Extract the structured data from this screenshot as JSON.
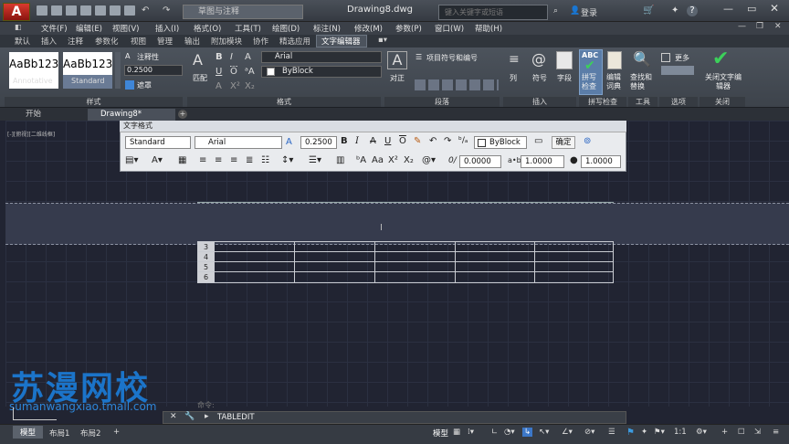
{
  "app": {
    "doc_title": "Drawing8.dwg",
    "workspace": "草图与注释",
    "search_placeholder": "键入关键字或短语",
    "login": "登录"
  },
  "menu": [
    "文件(F)",
    "编辑(E)",
    "视图(V)",
    "插入(I)",
    "格式(O)",
    "工具(T)",
    "绘图(D)",
    "标注(N)",
    "修改(M)",
    "参数(P)",
    "窗口(W)",
    "帮助(H)"
  ],
  "ribbon_tabs": [
    "默认",
    "插入",
    "注释",
    "参数化",
    "视图",
    "管理",
    "输出",
    "附加模块",
    "协作",
    "精选应用",
    "文字编辑器"
  ],
  "ribbon": {
    "style1": "AaBb123",
    "style1_label": "Annotative",
    "style2": "AaBb123",
    "style2_label": "Standard",
    "annotative": "注释性",
    "height": "0.2500",
    "mask": "遮罩",
    "match": "匹配",
    "font": "Arial",
    "color": "ByBlock",
    "bullets": "项目符号和编号",
    "justify": "对正",
    "columns": "列",
    "symbol": "符号",
    "field": "字段",
    "spell": "拼写检查",
    "edit_dict": "编辑词典",
    "find": "查找和替换",
    "more": "更多",
    "close": "关闭文字编辑器",
    "panels": [
      "样式",
      "格式",
      "段落",
      "插入",
      "拼写检查",
      "工具",
      "选项",
      "关闭"
    ]
  },
  "doc_tabs": [
    "开始",
    "Drawing8*"
  ],
  "viewport_label": "[-][俯视][二维线框]",
  "text_format": {
    "title": "文字格式",
    "style": "Standard",
    "font": "Arial",
    "height": "0.2500",
    "color": "ByBlock",
    "ok": "确定",
    "oblique": "0.0000",
    "tracking": "1.0000",
    "width": "1.0000"
  },
  "table_rows": [
    "3",
    "4",
    "5",
    "6"
  ],
  "cmd": {
    "history": "命令:",
    "prompt": "TABLEDIT"
  },
  "status": {
    "model": "模型",
    "layout1": "布局1",
    "layout2": "布局2",
    "model_btn": "模型",
    "scale": "1:1"
  },
  "watermark": {
    "name": "苏漫网校",
    "url": "sumanwangxiao.tmall.com"
  }
}
